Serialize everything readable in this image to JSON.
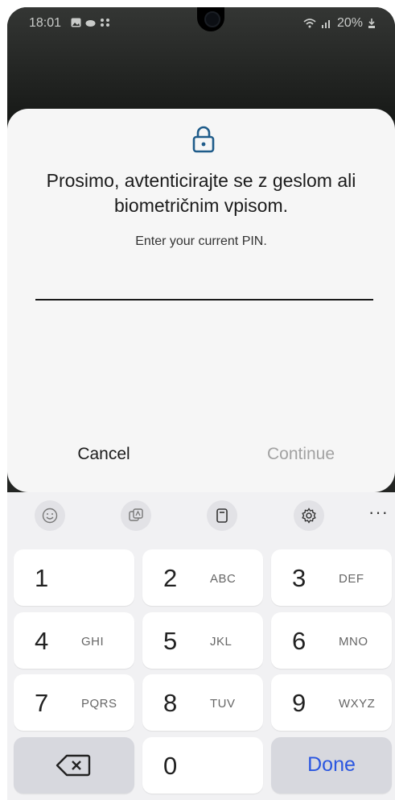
{
  "status_bar": {
    "time": "18:01",
    "battery": "20%"
  },
  "dialog": {
    "title": "Prosimo, avtenticirajte se z geslom ali biometričnim vpisom.",
    "subtitle": "Enter your current PIN.",
    "pin_value": "",
    "cancel_label": "Cancel",
    "continue_label": "Continue"
  },
  "keyboard": {
    "toolbar_icons": [
      "emoji-icon",
      "sticker-icon",
      "clipboard-icon",
      "settings-icon",
      "more-icon"
    ],
    "more_label": "···",
    "keys": [
      {
        "num": "1",
        "letters": ""
      },
      {
        "num": "2",
        "letters": "ABC"
      },
      {
        "num": "3",
        "letters": "DEF"
      },
      {
        "num": "4",
        "letters": "GHI"
      },
      {
        "num": "5",
        "letters": "JKL"
      },
      {
        "num": "6",
        "letters": "MNO"
      },
      {
        "num": "7",
        "letters": "PQRS"
      },
      {
        "num": "8",
        "letters": "TUV"
      },
      {
        "num": "9",
        "letters": "WXYZ"
      },
      {
        "num": "0",
        "letters": ""
      }
    ],
    "done_label": "Done"
  },
  "colors": {
    "accent": "#2a56e0",
    "lock_icon": "#1f5c8a",
    "disabled_text": "#a2a2a2"
  }
}
